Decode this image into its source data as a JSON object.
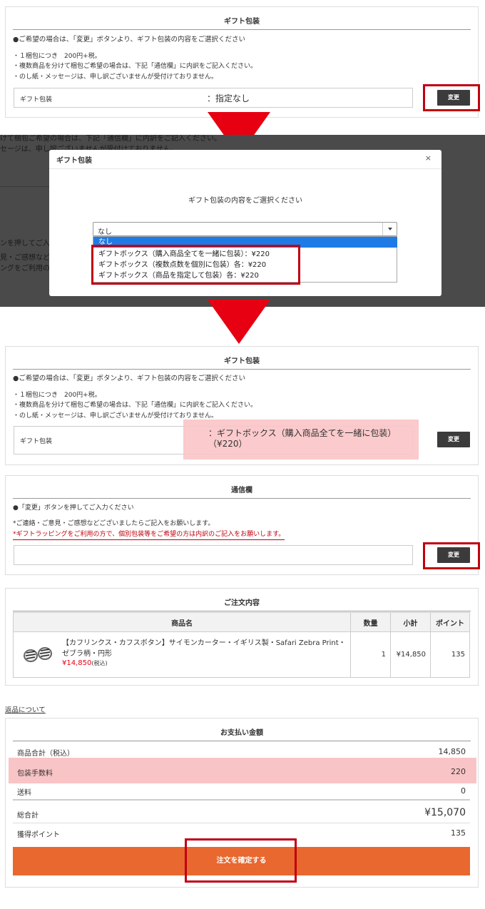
{
  "gift_panel": {
    "title": "ギフト包装",
    "intro": "●ご希望の場合は、「変更」ボタンより、ギフト包装の内容をご選択ください",
    "notes": [
      "・１梱包につき　200円+税。",
      "・複数商品を分けて梱包ご希望の場合は、下記「通信欄」に内訳をご記入ください。",
      "・のし紙・メッセージは、申し訳ございませんが受付けておりません。"
    ],
    "field_label": "ギフト包装",
    "value_before": "：指定なし",
    "value_after": "：ギフトボックス（購入商品全てを一緒に包装）（¥220）",
    "button_label": "変更"
  },
  "background_ghost": {
    "lines": [
      "けて梱包ご希望の場合は、下記「通信欄」に内訳をご記入ください。",
      "セージは、申し訳ございませんが受付けておりません。",
      "ンを押してご入",
      "見・ご感想など",
      "ングをご利用の"
    ]
  },
  "modal": {
    "title": "ギフト包装",
    "close": "×",
    "prompt": "ギフト包装の内容をご選択ください",
    "select_value": "なし",
    "options": [
      "なし",
      "ギフトボックス（購入商品全てを一緒に包装）：¥220",
      "ギフトボックス（複数点数を個別に包装）各：¥220",
      "ギフトボックス（商品を指定して包装）各：¥220"
    ]
  },
  "message_panel": {
    "title": "通信欄",
    "intro": "●「変更」ボタンを押してご入力ください",
    "note1": "*ご連絡・ご意見・ご感想などございましたらご記入をお願いします。",
    "note2": "*ギフトラッピングをご利用の方で、個別包装等をご希望の方は内訳のご記入をお願いします。",
    "button_label": "変更"
  },
  "order_panel": {
    "title": "ご注文内容",
    "headers": [
      "商品名",
      "数量",
      "小計",
      "ポイント"
    ],
    "item": {
      "name": "【カフリンクス・カフスボタン】サイモンカーター・イギリス製・Safari Zebra Print・ゼブラ柄・円形",
      "price": "¥14,850",
      "tax_note": "(税込)",
      "qty": "1",
      "subtotal": "¥14,850",
      "points": "135"
    }
  },
  "returns_link": "返品について",
  "payment_panel": {
    "title": "お支払い金額",
    "rows": [
      {
        "label": "商品合計（税込）",
        "value": "14,850"
      },
      {
        "label": "包装手数料",
        "value": "220"
      },
      {
        "label": "送料",
        "value": "0"
      },
      {
        "label": "総合計",
        "value": "¥15,070"
      },
      {
        "label": "獲得ポイント",
        "value": "135"
      }
    ],
    "confirm_label": "注文を確定する"
  },
  "colors": {
    "accent_red": "#c0000f",
    "arrow_red": "#e60012",
    "confirm_orange": "#e8682f",
    "highlight_pink": "#f9c4c6",
    "select_blue": "#1e7be6",
    "price_red": "#e60012"
  }
}
